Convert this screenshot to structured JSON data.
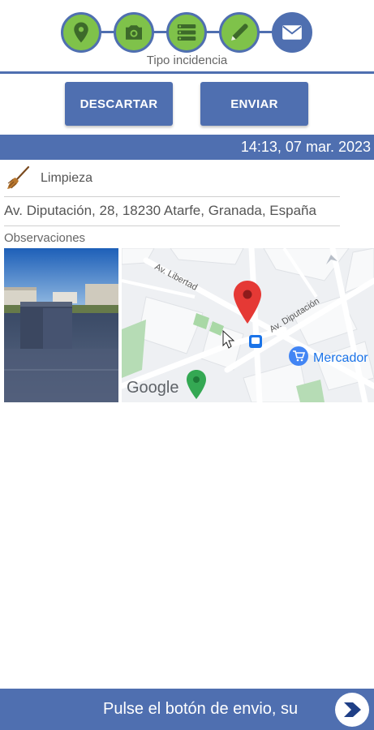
{
  "stepper": {
    "caption": "Tipo incidencia",
    "steps": [
      {
        "icon": "location-pin-icon",
        "state": "done"
      },
      {
        "icon": "camera-icon",
        "state": "done"
      },
      {
        "icon": "list-icon",
        "state": "done"
      },
      {
        "icon": "pencil-icon",
        "state": "done"
      },
      {
        "icon": "envelope-icon",
        "state": "active"
      }
    ]
  },
  "actions": {
    "discard_label": "DESCARTAR",
    "send_label": "ENVIAR"
  },
  "header": {
    "datetime": "14:13, 07 mar. 2023"
  },
  "incident": {
    "category_icon": "broom-icon",
    "category": "Limpieza",
    "address": "Av. Diputación, 28, 18230 Atarfe, Granada, España",
    "observations_label": "Observaciones"
  },
  "map": {
    "streets": [
      "Av. Libertad",
      "Av. Diputación"
    ],
    "place": "Mercador",
    "logo": "Google"
  },
  "footer": {
    "text": "Pulse el botón de envio, su",
    "next_icon": "chevron-right-icon"
  },
  "colors": {
    "primary": "#4f6fb0",
    "step_done": "#7fc24a",
    "marker": "#e53935"
  }
}
